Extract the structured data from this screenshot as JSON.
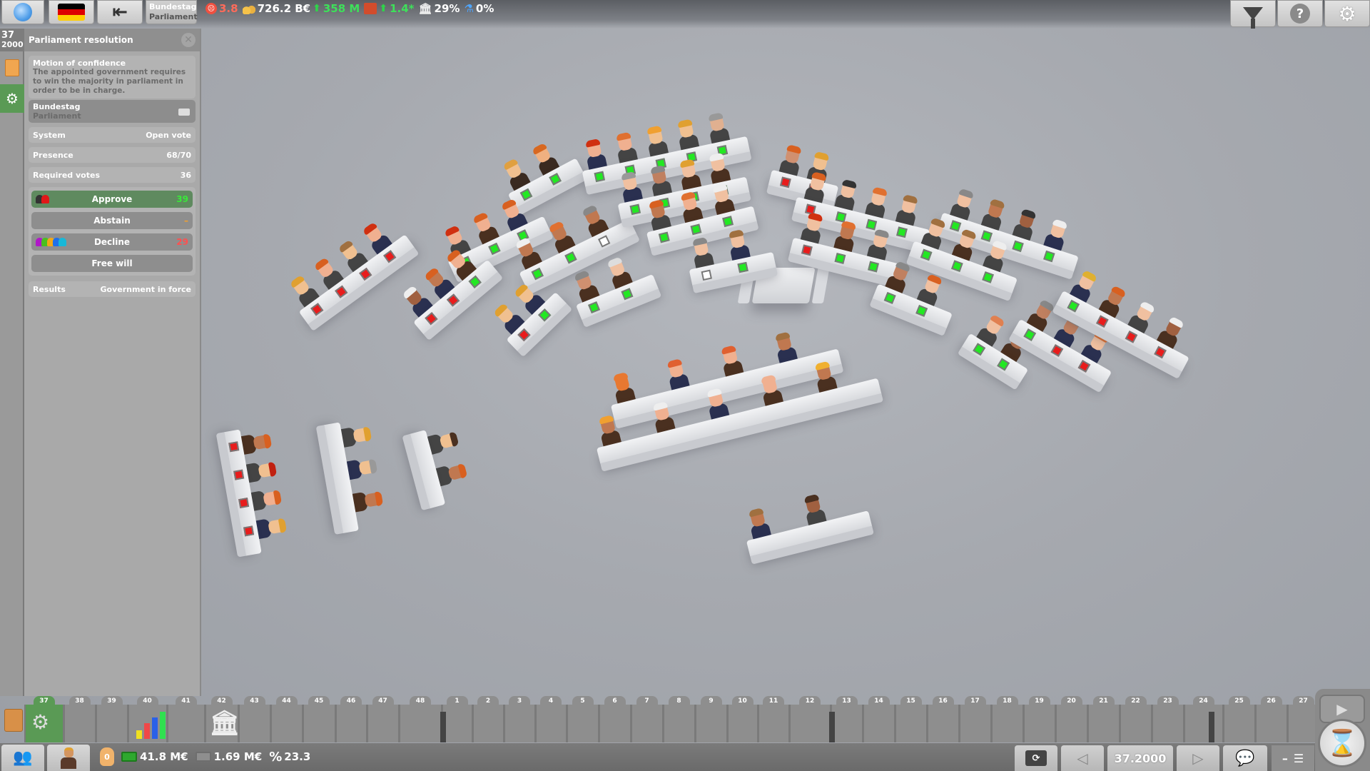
{
  "topbar": {
    "globe_icon": "globe-icon",
    "flag_colors": [
      "#000000",
      "#dd0000",
      "#ffce00"
    ],
    "back_icon": "exit-arrow-icon",
    "chamber_line1": "Bundestag",
    "chamber_line2": "Parliament",
    "stats": {
      "unhappiness": "3.8",
      "budget": "726.2 B€",
      "budget_change": "358 M",
      "growth": "1.4*",
      "approval": "29%",
      "research": "0%"
    },
    "colors": {
      "unhappiness": "#ff6b5a",
      "change": "#3ee05a",
      "white": "#ffffff"
    },
    "right_buttons": [
      "filter-icon",
      "help-icon",
      "settings-icon"
    ],
    "help_glyph": "?"
  },
  "sidebar": {
    "week": "37",
    "year": "2000"
  },
  "panel": {
    "title": "Parliament resolution",
    "close_glyph": "✕",
    "motion_title": "Motion of confidence",
    "motion_desc": "The appointed government requires to win the majority in parliament in order to be in charge.",
    "chamber_name": "Bundestag",
    "chamber_type": "Parliament",
    "rows": [
      {
        "label": "System",
        "value": "Open vote"
      },
      {
        "label": "Presence",
        "value": "68/70"
      },
      {
        "label": "Required votes",
        "value": "36"
      }
    ],
    "votes": {
      "approve": {
        "label": "Approve",
        "count": "39",
        "color": "#39e839",
        "party_colors": [
          "#333333",
          "#e01818"
        ]
      },
      "abstain": {
        "label": "Abstain",
        "count": "–",
        "color": "#f0a030"
      },
      "decline": {
        "label": "Decline",
        "count": "29",
        "color": "#ff5050",
        "party_colors": [
          "#b018c8",
          "#48c020",
          "#f0a818",
          "#2070e8",
          "#18b8d8"
        ]
      },
      "free_will": {
        "label": "Free will"
      }
    },
    "result_label": "Results",
    "result_value": "Government in force"
  },
  "timeline": {
    "weeks": [
      "37",
      "38",
      "39",
      "40",
      "41",
      "42",
      "43",
      "44",
      "45",
      "46",
      "47",
      "48",
      "1",
      "2",
      "3",
      "4",
      "5",
      "6",
      "7",
      "8",
      "9",
      "10",
      "11",
      "12",
      "13",
      "14",
      "15",
      "16",
      "17",
      "18",
      "19",
      "20",
      "21",
      "22",
      "23",
      "24",
      "25",
      "26",
      "27"
    ],
    "active_week": "37",
    "events": {
      "40": "stats-chart-icon",
      "42": "bank-budget-icon",
      "37": "resolution-doc-icon"
    }
  },
  "bottombar": {
    "party_button_icon": "party-members-icon",
    "leader_button_icon": "leader-portrait-icon",
    "influence": "0",
    "cash": "41.8 M€",
    "debt": "1.69 M€",
    "rate": "23.3",
    "rate_symbol": "%",
    "current_date": "37.2000",
    "prev_glyph": "◁",
    "next_glyph": "▷",
    "play_glyph": "▶",
    "hourglass_glyph": "⌛"
  },
  "scene": {
    "vote_colors": {
      "yes": "#22e822",
      "no": "#e81c1c",
      "pending": "#ffffff",
      "none": "transparent"
    },
    "benches": [
      {
        "seats": [
          {
            "hair": "#e0a040",
            "skin": "#f0c090",
            "suit": "#3a2a20",
            "vote": "yes"
          },
          {
            "hair": "#d86820",
            "skin": "#f0b080",
            "suit": "#3a2a20",
            "vote": "yes"
          }
        ]
      },
      {
        "seats": [
          {
            "hair": "#d03010",
            "skin": "#f0b090",
            "suit": "#444",
            "vote": "yes"
          },
          {
            "hair": "#d86020",
            "skin": "#f0b090",
            "suit": "#4a3020",
            "vote": "yes"
          },
          {
            "hair": "#d86020",
            "skin": "#f0b090",
            "suit": "#2a3050",
            "vote": "yes"
          }
        ]
      },
      {
        "seats": [
          {
            "hair": "#eeeeee",
            "skin": "#c07850",
            "suit": "#4a3020",
            "vote": "yes"
          },
          {
            "hair": "#e07030",
            "skin": "#c07850",
            "suit": "#4a3020",
            "vote": "yes"
          },
          {
            "hair": "#888",
            "skin": "#c07850",
            "suit": "#4a3020",
            "vote": "pending"
          }
        ]
      },
      {
        "seats": [
          {
            "hair": "#888",
            "skin": "#d09070",
            "suit": "#4a3020",
            "vote": "yes"
          },
          {
            "hair": "#ddd",
            "skin": "#f0c0a0",
            "suit": "#4a3020",
            "vote": "yes"
          }
        ]
      },
      {
        "seats": [
          {
            "hair": "#d03010",
            "skin": "#f0b090",
            "suit": "#2a3050",
            "vote": "yes"
          },
          {
            "hair": "#e07030",
            "skin": "#f0b090",
            "suit": "#444",
            "vote": "yes"
          },
          {
            "hair": "#f0a030",
            "skin": "#f0c090",
            "suit": "#444",
            "vote": "yes"
          },
          {
            "hair": "#e0a030",
            "skin": "#f0c090",
            "suit": "#444",
            "vote": "yes"
          },
          {
            "hair": "#999",
            "skin": "#e0b090",
            "suit": "#444",
            "vote": "yes"
          }
        ]
      },
      {
        "seats": [
          {
            "hair": "#999",
            "skin": "#f0c0a0",
            "suit": "#2a3050",
            "vote": "yes"
          },
          {
            "hair": "#888",
            "skin": "#c08060",
            "suit": "#444",
            "vote": "yes"
          },
          {
            "hair": "#e0a030",
            "skin": "#f0c0a0",
            "suit": "#4a3020",
            "vote": "yes"
          },
          {
            "hair": "#eee",
            "skin": "#f0c0a0",
            "suit": "#4a3020",
            "vote": "yes"
          }
        ]
      },
      {
        "seats": [
          {
            "hair": "#d86020",
            "skin": "#c07850",
            "suit": "#444",
            "vote": "yes"
          },
          {
            "hair": "#e07030",
            "skin": "#f0b090",
            "suit": "#4a3020",
            "vote": "yes"
          },
          {
            "hair": "#eee",
            "skin": "#f0c0a0",
            "suit": "#4a3020",
            "vote": "yes"
          }
        ]
      },
      {
        "seats": [
          {
            "hair": "#888",
            "skin": "#f0c0a0",
            "suit": "#444",
            "vote": "pending"
          },
          {
            "hair": "#a07040",
            "skin": "#f0c0a0",
            "suit": "#2a3050",
            "vote": "yes"
          }
        ]
      },
      {
        "seats": [
          {
            "hair": "#d86020",
            "skin": "#d09070",
            "suit": "#444",
            "vote": "no"
          },
          {
            "hair": "#e0a030",
            "skin": "#f0c090",
            "suit": "#444",
            "vote": "no"
          }
        ]
      },
      {
        "seats": [
          {
            "hair": "#d86020",
            "skin": "#f0c0a0",
            "suit": "#444",
            "vote": "no"
          },
          {
            "hair": "#333",
            "skin": "#f0c0a0",
            "suit": "#444",
            "vote": "yes"
          },
          {
            "hair": "#e07030",
            "skin": "#f0c0a0",
            "suit": "#444",
            "vote": "yes"
          },
          {
            "hair": "#a07040",
            "skin": "#f0c0a0",
            "suit": "#444",
            "vote": "yes"
          }
        ]
      },
      {
        "seats": [
          {
            "hair": "#d03010",
            "skin": "#f0c0a0",
            "suit": "#444",
            "vote": "no"
          },
          {
            "hair": "#e07030",
            "skin": "#c07850",
            "suit": "#4a3020",
            "vote": "yes"
          },
          {
            "hair": "#888",
            "skin": "#f0c0a0",
            "suit": "#444",
            "vote": "yes"
          }
        ]
      },
      {
        "seats": [
          {
            "hair": "#888",
            "skin": "#f0c0a0",
            "suit": "#444",
            "vote": "yes"
          },
          {
            "hair": "#a07040",
            "skin": "#c07850",
            "suit": "#444",
            "vote": "yes"
          },
          {
            "hair": "#333",
            "skin": "#a06040",
            "suit": "#444",
            "vote": "yes"
          },
          {
            "hair": "#eee",
            "skin": "#f0c0a0",
            "suit": "#2a3050",
            "vote": "yes"
          }
        ]
      },
      {
        "seats": [
          {
            "hair": "#a07040",
            "skin": "#f0c0a0",
            "suit": "#444",
            "vote": "yes"
          },
          {
            "hair": "#a07040",
            "skin": "#f0c0a0",
            "suit": "#4a3020",
            "vote": "yes"
          },
          {
            "hair": "#eee",
            "skin": "#f0c0a0",
            "suit": "#444",
            "vote": "yes"
          }
        ]
      },
      {
        "seats": [
          {
            "hair": "#888",
            "skin": "#c08060",
            "suit": "#4a3020",
            "vote": "yes"
          },
          {
            "hair": "#d86020",
            "skin": "#f0c0a0",
            "suit": "#444",
            "vote": "yes"
          }
        ]
      },
      {
        "seats": [
          {
            "hair": "#e08050",
            "skin": "#f0c0a0",
            "suit": "#444",
            "vote": "yes"
          },
          {
            "hair": "#d86020",
            "skin": "#c07850",
            "suit": "#4a3020",
            "vote": "yes"
          }
        ]
      },
      {
        "seats": [
          {
            "hair": "#888",
            "skin": "#c08060",
            "suit": "#4a3020",
            "vote": "yes"
          },
          {
            "hair": "#888",
            "skin": "#c08060",
            "suit": "#2a3050",
            "vote": "no"
          },
          {
            "hair": "#e07030",
            "skin": "#f0c0a0",
            "suit": "#2a3050",
            "vote": "no"
          }
        ]
      },
      {
        "seats": [
          {
            "hair": "#e0b030",
            "skin": "#f0c0a0",
            "suit": "#2a3050",
            "vote": "yes"
          },
          {
            "hair": "#d86020",
            "skin": "#c07850",
            "suit": "#4a3020",
            "vote": "no"
          },
          {
            "hair": "#eee",
            "skin": "#f0c0a0",
            "suit": "#444",
            "vote": "no"
          },
          {
            "hair": "#eee",
            "skin": "#a06040",
            "suit": "#4a3020",
            "vote": "no"
          }
        ]
      },
      {
        "seats": [
          {
            "hair": "#e0a030",
            "skin": "#f0c090",
            "suit": "#444",
            "vote": "no"
          },
          {
            "hair": "#d86020",
            "skin": "#f0b090",
            "suit": "#444",
            "vote": "no"
          },
          {
            "hair": "#a07040",
            "skin": "#f0c090",
            "suit": "#444",
            "vote": "no"
          },
          {
            "hair": "#d03010",
            "skin": "#f0b090",
            "suit": "#2a3050",
            "vote": "no"
          }
        ]
      },
      {
        "seats": [
          {
            "hair": "#eee",
            "skin": "#a06040",
            "suit": "#2a3050",
            "vote": "no"
          },
          {
            "hair": "#d86020",
            "skin": "#c07850",
            "suit": "#2a3050",
            "vote": "no"
          },
          {
            "hair": "#d86020",
            "skin": "#f0b090",
            "suit": "#4a3020",
            "vote": "yes"
          }
        ]
      },
      {
        "seats": [
          {
            "hair": "#e0a030",
            "skin": "#f0c090",
            "suit": "#2a3050",
            "vote": "no"
          },
          {
            "hair": "#e0a030",
            "skin": "#f0c090",
            "suit": "#2a3050",
            "vote": "yes"
          }
        ]
      },
      {
        "seats": [
          {
            "hair": "#d86020",
            "skin": "#c07850",
            "suit": "#4a3020",
            "vote": "no"
          },
          {
            "hair": "#c02010",
            "skin": "#f0c090",
            "suit": "#444",
            "vote": "no"
          },
          {
            "hair": "#d86020",
            "skin": "#f0b090",
            "suit": "#444",
            "vote": "no"
          },
          {
            "hair": "#e0a030",
            "skin": "#f0c090",
            "suit": "#2a3050",
            "vote": "no"
          }
        ]
      },
      {
        "seats": [
          {
            "hair": "#e0a030",
            "skin": "#f0c090",
            "suit": "#444",
            "vote": "none"
          },
          {
            "hair": "#999",
            "skin": "#f0c090",
            "suit": "#2a3050",
            "vote": "none"
          },
          {
            "hair": "#d86020",
            "skin": "#c07850",
            "suit": "#4a3020",
            "vote": "none"
          }
        ]
      },
      {
        "seats": [
          {
            "hair": "#4a3020",
            "skin": "#f0c090",
            "suit": "#444",
            "vote": "none"
          },
          {
            "hair": "#d86020",
            "skin": "#c07850",
            "suit": "#444",
            "vote": "none"
          }
        ]
      },
      {
        "seats": [
          {
            "hair": "#e87830",
            "skin": "#e87830",
            "suit": "#4a3020",
            "vote": "none"
          },
          {
            "hair": "#e06030",
            "skin": "#f0b090",
            "suit": "#2a3050",
            "vote": "none"
          },
          {
            "hair": "#e06030",
            "skin": "#f0b090",
            "suit": "#4a3020",
            "vote": "none"
          },
          {
            "hair": "#a07040",
            "skin": "#c07850",
            "suit": "#2a3050",
            "vote": "none"
          }
        ]
      },
      {
        "seats": [
          {
            "hair": "#f0a030",
            "skin": "#c07850",
            "suit": "#4a3020",
            "vote": "none"
          },
          {
            "hair": "#eee",
            "skin": "#f0b090",
            "suit": "#4a3020",
            "vote": "none"
          },
          {
            "hair": "#eee",
            "skin": "#f0b090",
            "suit": "#2a3050",
            "vote": "none"
          },
          {
            "hair": "#f0b090",
            "skin": "#f0b090",
            "suit": "#4a3020",
            "vote": "none"
          },
          {
            "hair": "#f0b030",
            "skin": "#c07850",
            "suit": "#4a3020",
            "vote": "none"
          }
        ]
      },
      {
        "seats": [
          {
            "hair": "#a07040",
            "skin": "#c07850",
            "suit": "#2a3050",
            "vote": "none"
          },
          {
            "hair": "#4a3020",
            "skin": "#a06040",
            "suit": "#444",
            "vote": "none"
          }
        ]
      }
    ]
  }
}
